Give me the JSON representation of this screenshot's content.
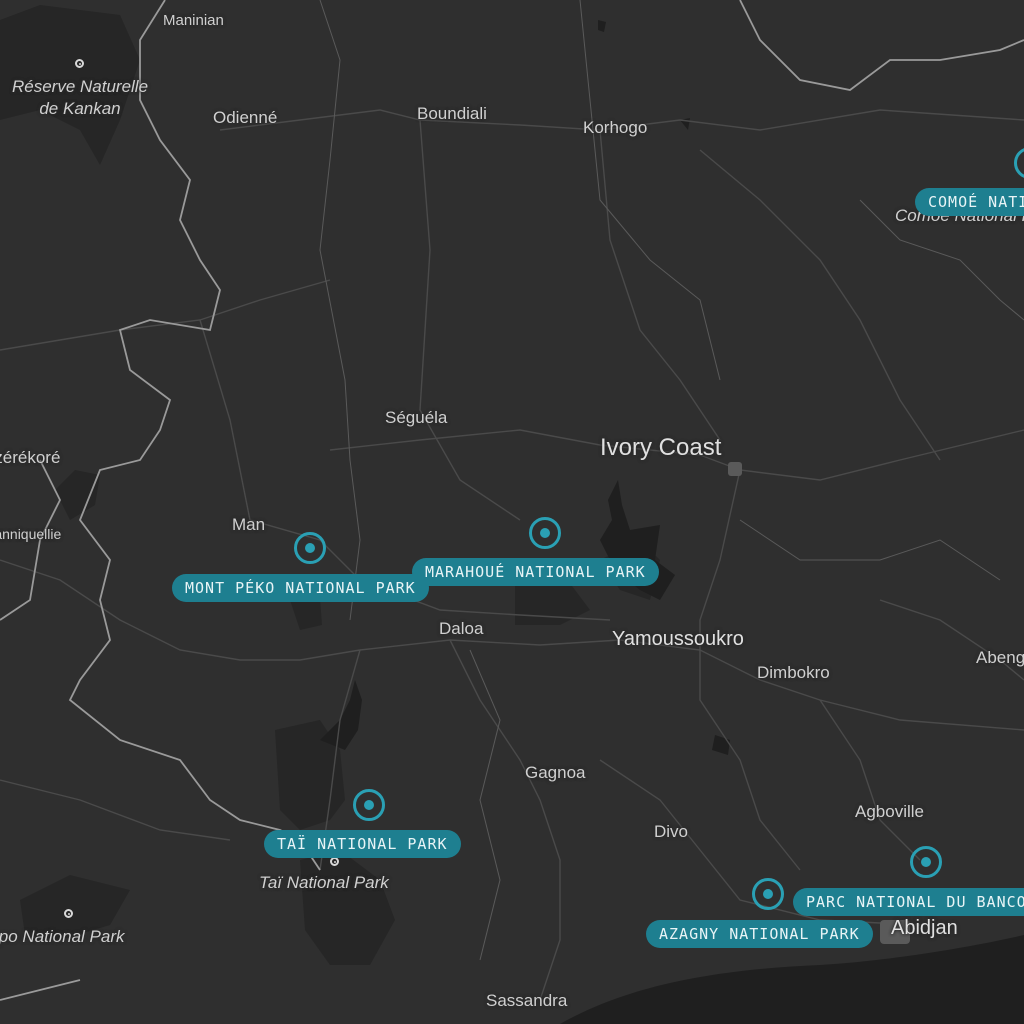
{
  "map": {
    "country_label": "Ivory Coast",
    "places": {
      "maninian": "Maninian",
      "kankan_reserve": "Réserve Naturelle\nde Kankan",
      "odienne": "Odienné",
      "boundiali": "Boundiali",
      "korhogo": "Korhogo",
      "comoe_park": "Comoé National Park",
      "seguela": "Séguéla",
      "nzerekore": "Nzérékoré",
      "sanniquellie": "Sanniquellie",
      "man": "Man",
      "daloa": "Daloa",
      "yamoussoukro": "Yamoussoukro",
      "dimbokro": "Dimbokro",
      "abengourou": "Abengourou",
      "gagnoa": "Gagnoa",
      "agboville": "Agboville",
      "divo": "Divo",
      "tai_park": "Taï National Park",
      "sapo_park": "Sapo National Park",
      "abidjan": "Abidjan",
      "sassandra": "Sassandra"
    },
    "markers": [
      {
        "id": "comoe",
        "label": "COMOÉ NATIONAL PARK"
      },
      {
        "id": "mont-peko",
        "label": "MONT PÉKO NATIONAL PARK"
      },
      {
        "id": "marahoue",
        "label": "MARAHOUÉ NATIONAL PARK"
      },
      {
        "id": "tai",
        "label": "TAÏ NATIONAL PARK"
      },
      {
        "id": "azagny",
        "label": "AZAGNY NATIONAL PARK"
      },
      {
        "id": "banco",
        "label": "PARC NATIONAL DU BANCO"
      }
    ],
    "colors": {
      "land": "#2f2f2f",
      "protected_area": "#262626",
      "water": "#1f1f1f",
      "border": "#9a9a9a",
      "road": "#4a4a4a",
      "marker": "#2aa0b4",
      "label_bg": "#1e7f90"
    }
  }
}
